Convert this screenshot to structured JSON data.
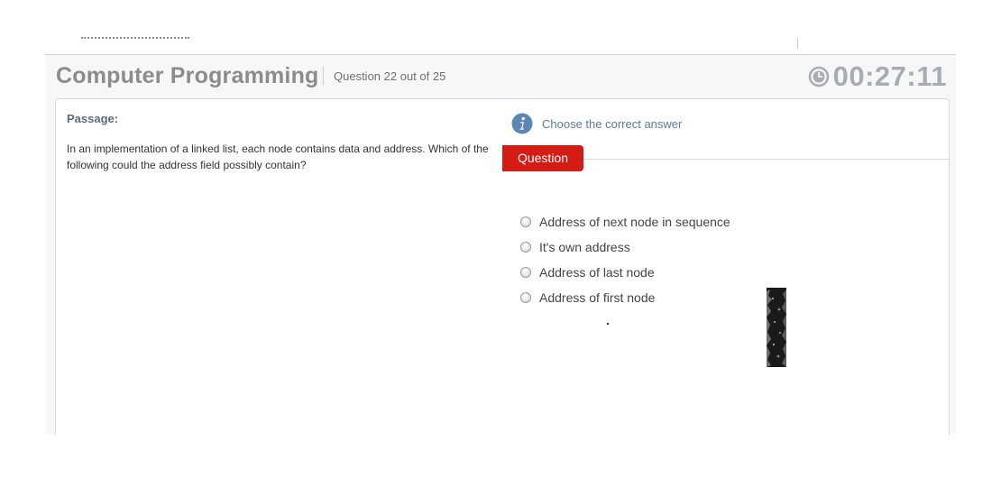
{
  "header": {
    "title": "Computer Programming",
    "question_counter": "Question 22 out of 25",
    "timer": "00:27:11",
    "timer_icon": "clock-icon"
  },
  "passage": {
    "label": "Passage:",
    "text": "In an implementation of a linked list, each node contains data and address. Which of the following could the address field possibly contain?"
  },
  "question_panel": {
    "instruction_icon": "info-icon",
    "instruction": "Choose the correct answer",
    "tab_label": "Question",
    "options": [
      "Address of next node in sequence",
      "It's own address",
      "Address of last node",
      "Address of first node"
    ]
  },
  "colors": {
    "accent_red": "#d41b14",
    "info_blue": "#5b87b4",
    "title_gray": "#8c8c8c",
    "timer_gray": "#a7adb4"
  }
}
